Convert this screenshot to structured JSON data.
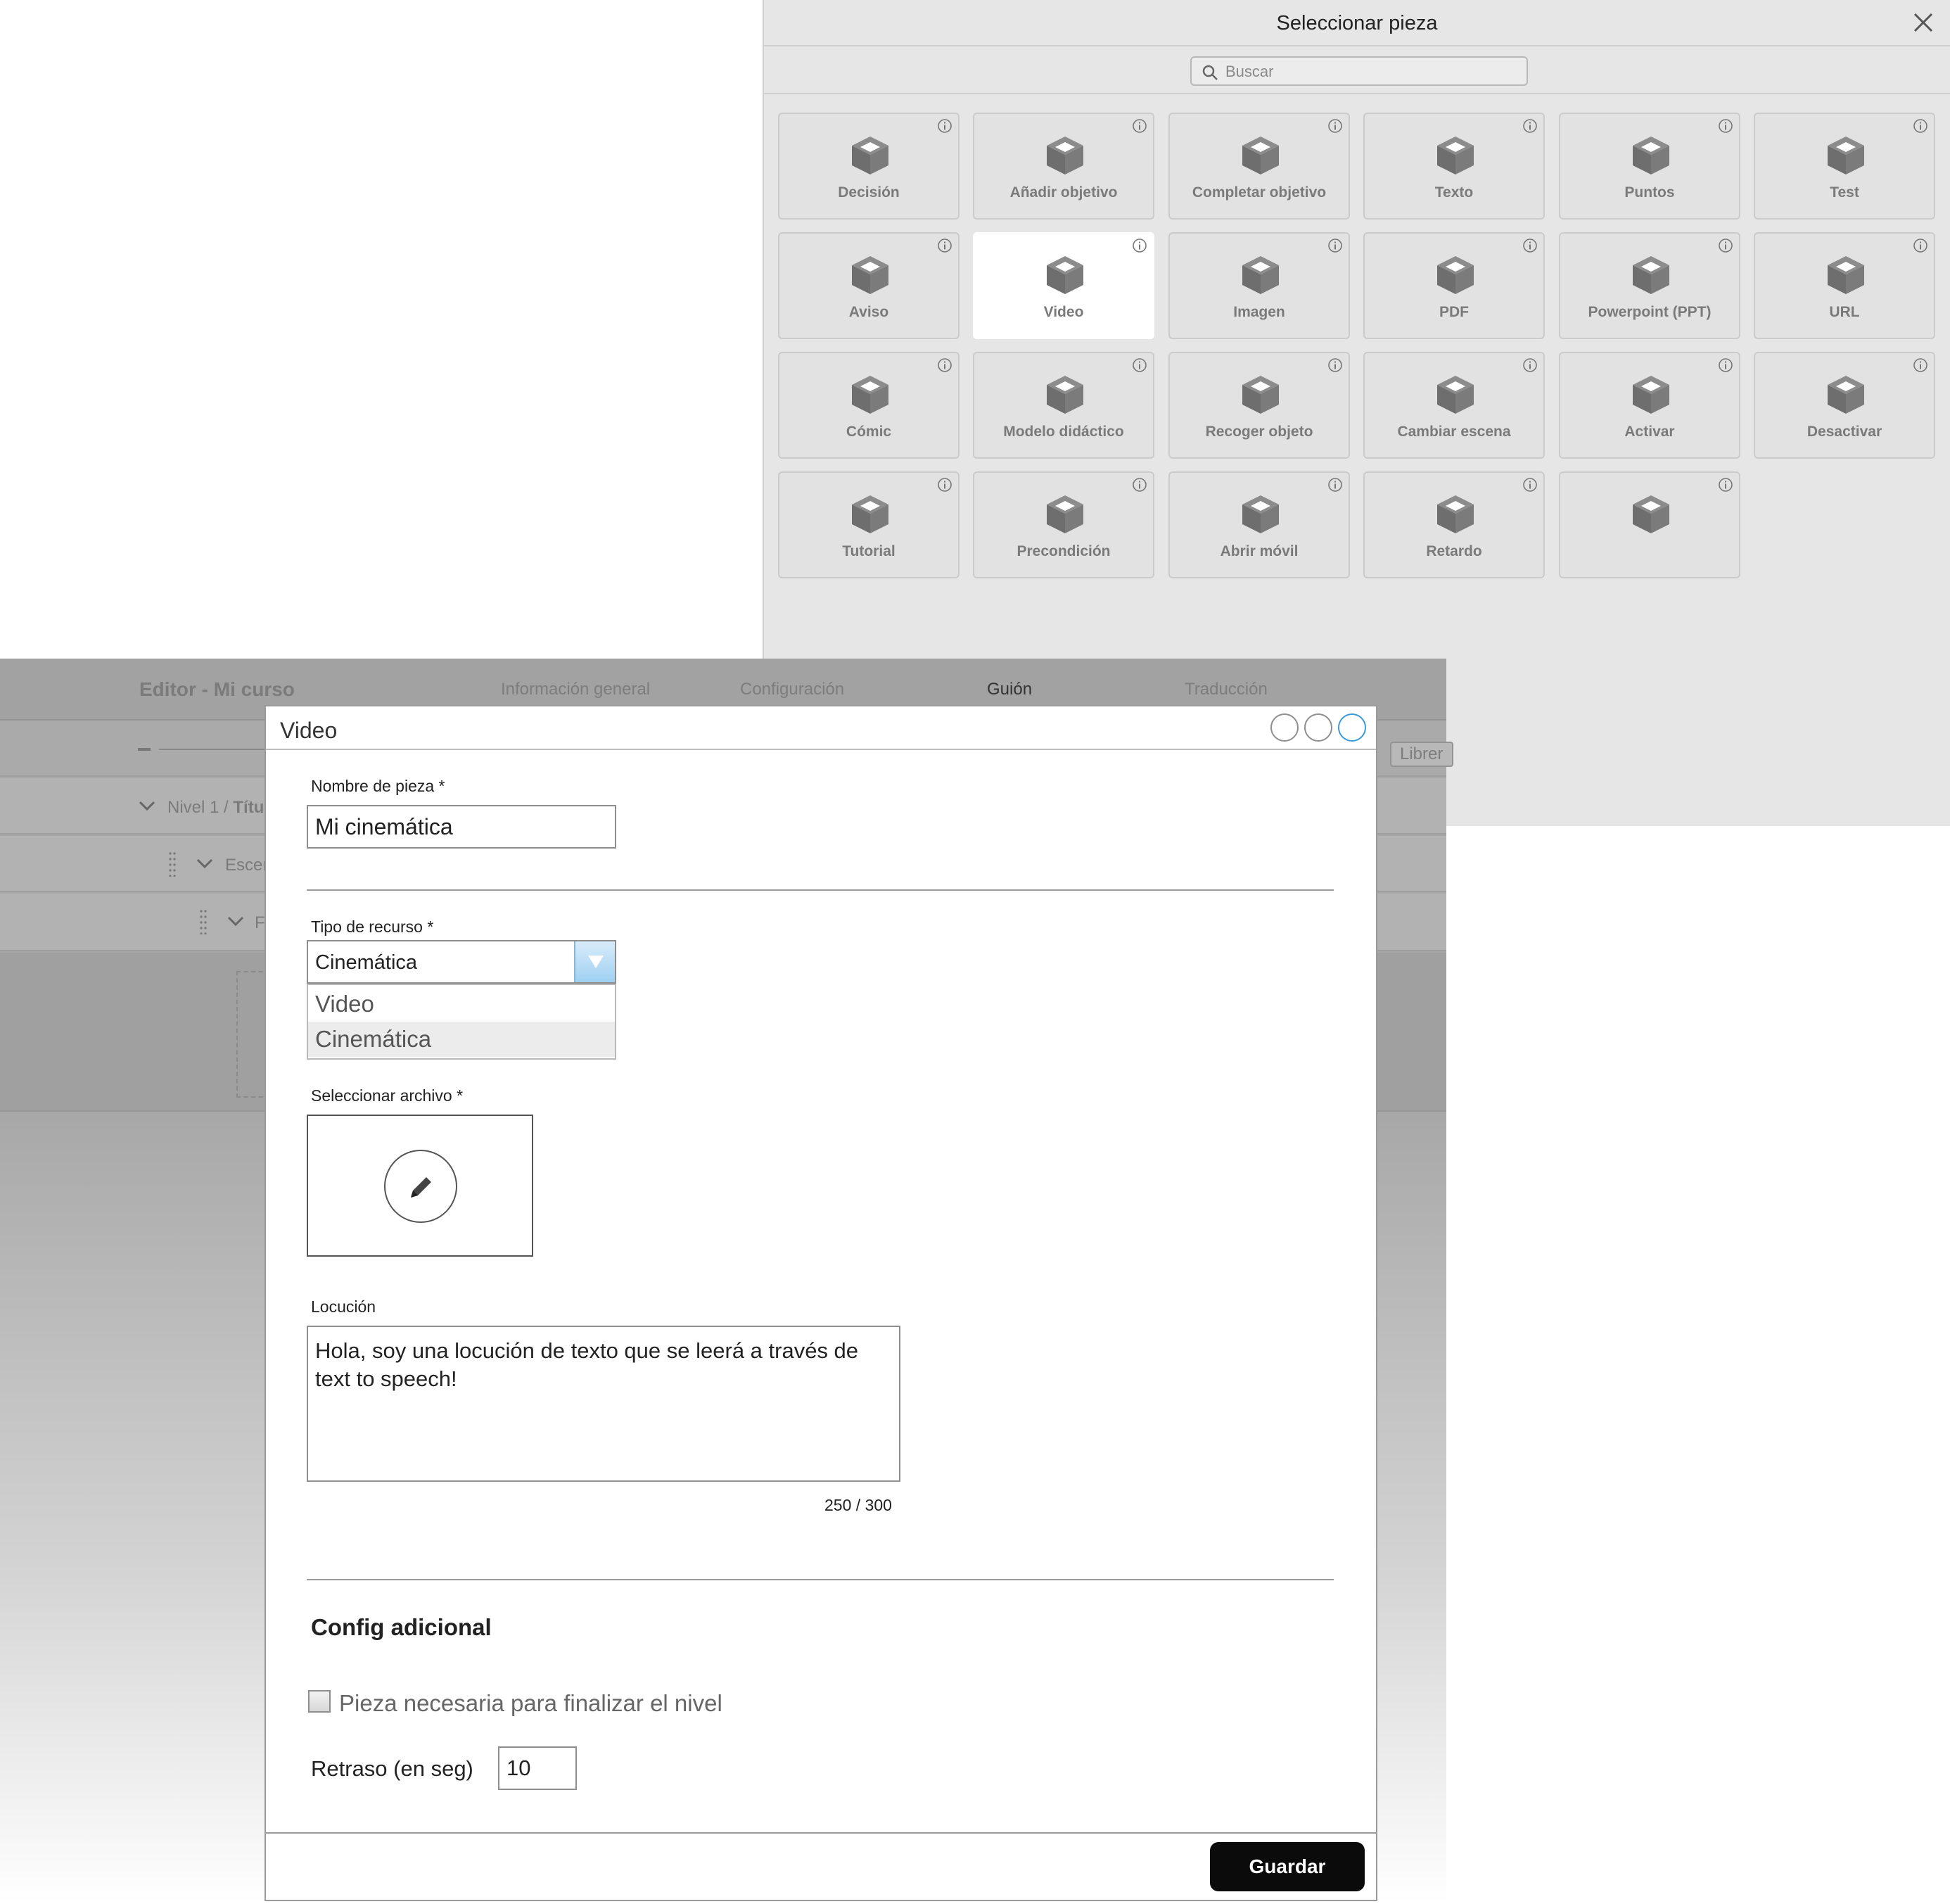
{
  "selector": {
    "title": "Seleccionar pieza",
    "search_placeholder": "Buscar",
    "pieces": [
      {
        "label": "Decisión",
        "selected": false
      },
      {
        "label": "Añadir objetivo",
        "selected": false
      },
      {
        "label": "Completar objetivo",
        "selected": false
      },
      {
        "label": "Texto",
        "selected": false
      },
      {
        "label": "Puntos",
        "selected": false
      },
      {
        "label": "Test",
        "selected": false
      },
      {
        "label": "Aviso",
        "selected": false
      },
      {
        "label": "Video",
        "selected": true
      },
      {
        "label": "Imagen",
        "selected": false
      },
      {
        "label": "PDF",
        "selected": false
      },
      {
        "label": "Powerpoint (PPT)",
        "selected": false
      },
      {
        "label": "URL",
        "selected": false
      },
      {
        "label": "Cómic",
        "selected": false
      },
      {
        "label": "Modelo didáctico",
        "selected": false
      },
      {
        "label": "Recoger objeto",
        "selected": false
      },
      {
        "label": "Cambiar escena",
        "selected": false
      },
      {
        "label": "Activar",
        "selected": false
      },
      {
        "label": "Desactivar",
        "selected": false
      },
      {
        "label": "Tutorial",
        "selected": false
      },
      {
        "label": "Precondición",
        "selected": false
      },
      {
        "label": "Abrir móvil",
        "selected": false
      },
      {
        "label": "Retardo",
        "selected": false
      },
      {
        "label": "",
        "selected": false
      }
    ]
  },
  "editor": {
    "title": "Editor - Mi curso",
    "tabs": [
      {
        "label": "Información general",
        "active": false
      },
      {
        "label": "Configuración",
        "active": false
      },
      {
        "label": "Guión",
        "active": true
      },
      {
        "label": "Traducción",
        "active": false
      }
    ],
    "library_button": "Librer",
    "tree": {
      "level_prefix": "Nivel 1 / ",
      "level_name": "Títu",
      "scene": "Escer",
      "piece": "F"
    }
  },
  "modal": {
    "title": "Video",
    "piece_name_label": "Nombre de pieza *",
    "piece_name_value": "Mi cinemática",
    "resource_type_label": "Tipo de recurso *",
    "resource_type_value": "Cinemática",
    "resource_options": [
      {
        "label": "Video",
        "highlighted": false
      },
      {
        "label": "Cinemática",
        "highlighted": true
      }
    ],
    "file_label": "Seleccionar archivo *",
    "locution_label": "Locución",
    "locution_value": "Hola, soy una locución de texto que se leerá a través de text to speech!",
    "char_counter": "250 / 300",
    "extra_section_title": "Config adicional",
    "required_checkbox_label": "Pieza necesaria para finalizar el nivel",
    "required_checked": false,
    "delay_label": "Retraso (en seg)",
    "delay_value": "10",
    "save_label": "Guardar"
  },
  "colors": {
    "accent_blue": "#3a9ad9",
    "save_button": "#0b0b0b",
    "icon_gray": "#7a7a7a"
  }
}
